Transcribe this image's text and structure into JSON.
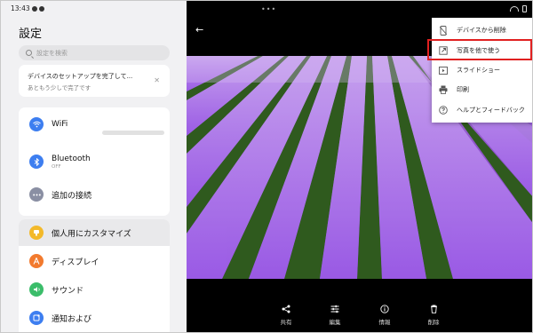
{
  "settings": {
    "status_time": "13:43",
    "title": "設定",
    "search_placeholder": "設定を検索",
    "setup_card": {
      "line1": "デバイスのセットアップを完了して...",
      "line2": "あともう少しで完了です"
    },
    "connections": [
      {
        "label": "WiFi",
        "sub": "",
        "icon": "wifi-icon",
        "color": "#3d7ef0"
      },
      {
        "label": "Bluetooth",
        "sub": "OFF",
        "icon": "bluetooth-icon",
        "color": "#3d7ef0"
      },
      {
        "label": "追加の接続",
        "sub": "",
        "icon": "more-icon",
        "color": "#8a8fa3"
      }
    ],
    "customize": [
      {
        "label": "個人用にカスタマイズ",
        "icon": "palette-icon",
        "color": "#f3b92a"
      },
      {
        "label": "ディスプレイ",
        "icon": "display-icon",
        "color": "#f27a2e"
      },
      {
        "label": "サウンド",
        "icon": "sound-icon",
        "color": "#3bbd6a"
      },
      {
        "label": "通知および",
        "icon": "notification-icon",
        "color": "#3d7ef0"
      }
    ]
  },
  "viewer": {
    "menu": [
      {
        "label": "デバイスから削除",
        "icon": "phone-delete-icon"
      },
      {
        "label": "写真を他で使う",
        "icon": "open-external-icon"
      },
      {
        "label": "スライドショー",
        "icon": "slideshow-icon"
      },
      {
        "label": "印刷",
        "icon": "print-icon"
      },
      {
        "label": "ヘルプとフィードバック",
        "icon": "help-icon"
      }
    ],
    "bottom_actions": [
      {
        "label": "共有",
        "icon": "share-icon"
      },
      {
        "label": "編集",
        "icon": "edit-sliders-icon"
      },
      {
        "label": "情報",
        "icon": "info-icon"
      },
      {
        "label": "削除",
        "icon": "trash-icon"
      }
    ],
    "highlight_color": "#e02020"
  }
}
